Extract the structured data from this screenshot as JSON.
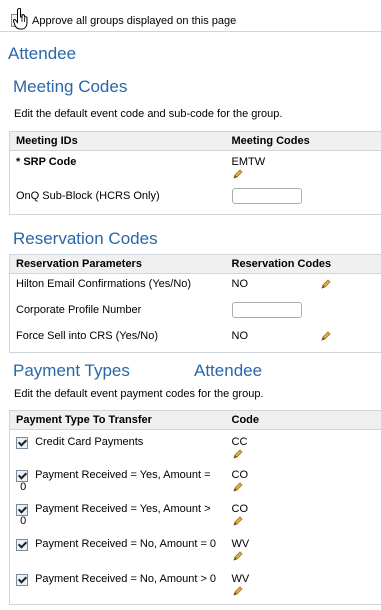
{
  "approve": {
    "label": "Approve all groups displayed on this page"
  },
  "attendee_heading": "Attendee",
  "meeting": {
    "title": "Meeting Codes",
    "description": "Edit the default event code and sub-code for the group.",
    "col1": "Meeting IDs",
    "col2": "Meeting Codes",
    "rows": [
      {
        "label": "* SRP Code",
        "value": "EMTW"
      },
      {
        "label": "OnQ Sub-Block (HCRS Only)",
        "value": ""
      }
    ]
  },
  "reservation": {
    "title": "Reservation Codes",
    "col1": "Reservation Parameters",
    "col2": "Reservation Codes",
    "rows": [
      {
        "label": "Hilton Email Confirmations (Yes/No)",
        "value": "NO"
      },
      {
        "label": "Corporate Profile Number",
        "value": ""
      },
      {
        "label": "Force Sell into CRS (Yes/No)",
        "value": "NO"
      }
    ]
  },
  "payment": {
    "title": "Payment Types",
    "subtitle": "Attendee",
    "description": "Edit the default event payment codes for the group.",
    "col1": "Payment Type To Transfer",
    "col2": "Code",
    "rows": [
      {
        "line1": "Credit Card Payments",
        "line2": "",
        "code": "CC"
      },
      {
        "line1": "Payment Received = Yes, Amount =",
        "line2": "0",
        "code": "CO"
      },
      {
        "line1": "Payment Received = Yes, Amount >",
        "line2": "0",
        "code": "CO"
      },
      {
        "line1": "Payment Received = No, Amount = 0",
        "line2": "",
        "code": "WV"
      },
      {
        "line1": "Payment Received = No, Amount > 0",
        "line2": "",
        "code": "WV"
      }
    ]
  },
  "icons": {
    "edit": "pencil-icon",
    "cursor": "hand-cursor-icon"
  }
}
